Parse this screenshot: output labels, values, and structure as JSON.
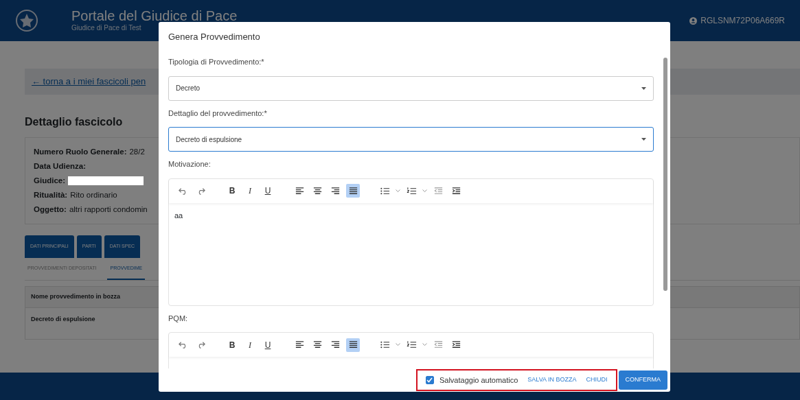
{
  "header": {
    "title": "Portale del Giudice di Pace",
    "subtitle": "Giudice di Pace di Test",
    "user": "RGLSNM72P06A669R"
  },
  "page": {
    "back_link": "← torna a i miei fascicoli pen",
    "section_title": "Dettaglio fascicolo",
    "details": [
      {
        "label": "Numero Ruolo Generale:",
        "value": "28/2",
        "redacted": false
      },
      {
        "label": "Data Udienza:",
        "redacted": false
      },
      {
        "label": "Giudice:",
        "redacted": true
      },
      {
        "label": "Ritualità:",
        "value": "Rito ordinario",
        "redacted": false
      },
      {
        "label": "Oggetto:",
        "value": "altri rapporti condomin",
        "redacted": false
      }
    ],
    "tabs": [
      "DATI PRINCIPALI",
      "PARTI",
      "DATI SPEC"
    ],
    "subtabs": [
      {
        "label": "PROVVEDIMENTI DEPOSITATI",
        "selected": false
      },
      {
        "label": "PROVVEDIME",
        "selected": true
      }
    ],
    "table": {
      "columns": [
        "Nome provvedimento in bozza"
      ],
      "rows": [
        [
          "Decreto di espulsione"
        ]
      ]
    }
  },
  "modal": {
    "title": "Genera Provvedimento",
    "fields": [
      {
        "label": "Tipologia di Provvedimento:*",
        "value": "Decreto",
        "focused": false
      },
      {
        "label": "Dettaglio del provvedimento:*",
        "value": "Decreto di espulsione",
        "focused": true
      }
    ],
    "editors": [
      {
        "label": "Motivazione:",
        "content": "aa",
        "toolbar": [
          {
            "kind": "undo",
            "selected": false
          },
          {
            "kind": "redo",
            "selected": false
          },
          {
            "kind": "bold",
            "label": "B",
            "selected": false
          },
          {
            "kind": "italic",
            "label": "I",
            "selected": false
          },
          {
            "kind": "underline",
            "label": "U",
            "selected": false
          },
          {
            "kind": "align-left",
            "selected": false
          },
          {
            "kind": "align-center",
            "selected": false
          },
          {
            "kind": "align-right",
            "selected": false
          },
          {
            "kind": "justify",
            "selected": true
          },
          {
            "kind": "bullets",
            "selected": false
          },
          {
            "kind": "numbers",
            "selected": false
          },
          {
            "kind": "outdent",
            "selected": false
          },
          {
            "kind": "indent",
            "selected": false
          }
        ]
      },
      {
        "label": "PQM:",
        "toolbar": [
          {
            "kind": "undo",
            "selected": false
          },
          {
            "kind": "redo",
            "selected": false
          },
          {
            "kind": "bold",
            "label": "B",
            "selected": false
          },
          {
            "kind": "italic",
            "label": "I",
            "selected": false
          },
          {
            "kind": "underline",
            "label": "U",
            "selected": false
          },
          {
            "kind": "align-left",
            "selected": false
          },
          {
            "kind": "align-center",
            "selected": false
          },
          {
            "kind": "align-right",
            "selected": false
          },
          {
            "kind": "justify",
            "selected": true
          },
          {
            "kind": "bullets",
            "selected": false
          },
          {
            "kind": "numbers",
            "selected": false
          },
          {
            "kind": "outdent",
            "selected": false
          },
          {
            "kind": "indent",
            "selected": false
          }
        ]
      }
    ],
    "footer": {
      "autosave": {
        "label": "Salvataggio automatico",
        "checked": true
      },
      "links": [
        "SALVA IN BOZZA",
        "CHIUDI"
      ],
      "confirm": "CONFERMA",
      "highlighted": true
    }
  }
}
